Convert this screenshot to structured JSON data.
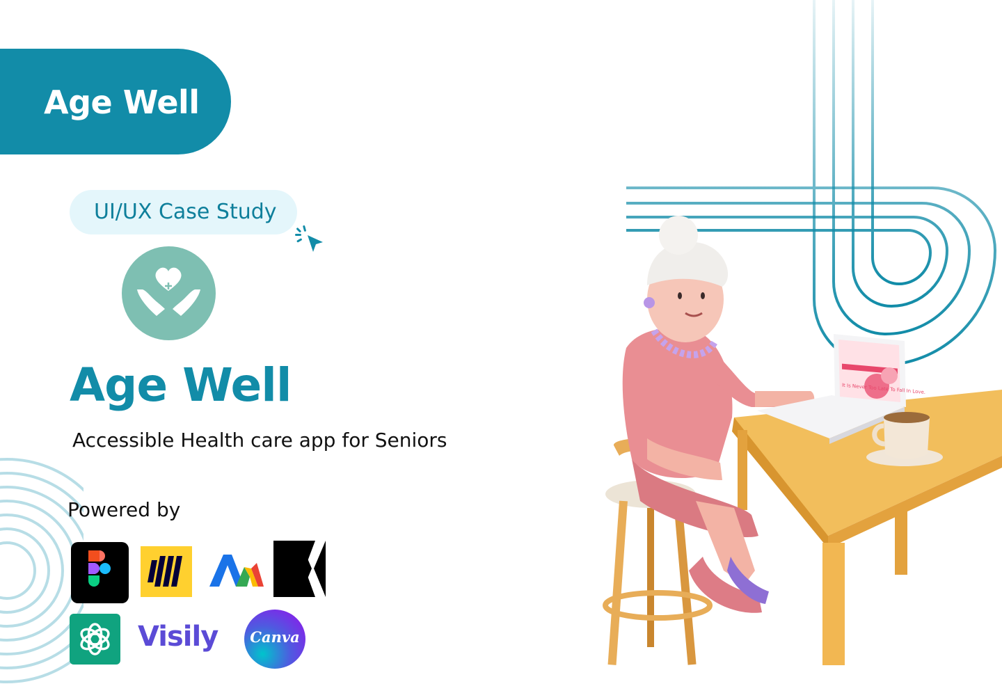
{
  "header": {
    "brand": "Age Well"
  },
  "chip": {
    "label": "UI/UX Case Study"
  },
  "hero": {
    "title": "Age Well",
    "subtitle": "Accessible Health care app for Seniors"
  },
  "powered": {
    "label": "Powered by",
    "tools": [
      {
        "name": "Figma",
        "icon": "figma-logo"
      },
      {
        "name": "Miro",
        "icon": "miro-logo"
      },
      {
        "name": "Google Ads",
        "icon": "google-ads-logo"
      },
      {
        "name": "Klaviyo",
        "icon": "k-logo"
      },
      {
        "name": "ChatGPT",
        "icon": "openai-logo"
      },
      {
        "name": "Visily",
        "icon": "visily-logo",
        "text": "Visily"
      },
      {
        "name": "Canva",
        "icon": "canva-logo",
        "text": "Canva"
      }
    ]
  },
  "colors": {
    "brand": "#128ca8",
    "chip_bg": "#e4f6fb",
    "logo_circle": "#7ebfb2",
    "laptop_accent": "#e8476b"
  },
  "illustration": {
    "laptop_screen_text": "It Is Never Too Late To Fall In Love."
  }
}
